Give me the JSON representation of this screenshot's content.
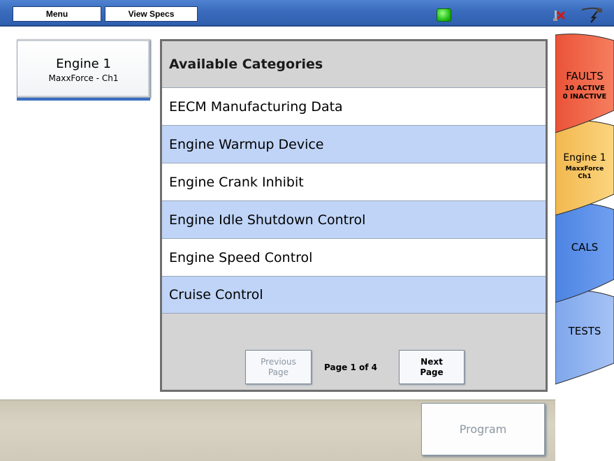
{
  "toolbar": {
    "menu_label": "Menu",
    "specs_label": "View Specs",
    "status_icon": "green-status-led-icon",
    "disconnect_icon": "disconnect-icon",
    "connector_icon": "connector-icon"
  },
  "module": {
    "title": "Engine 1",
    "subtitle": "MaxxForce - Ch1"
  },
  "categories": {
    "header": "Available Categories",
    "items": [
      {
        "label": "EECM Manufacturing Data"
      },
      {
        "label": "Engine Warmup Device"
      },
      {
        "label": "Engine Crank Inhibit"
      },
      {
        "label": "Engine Idle Shutdown Control"
      },
      {
        "label": "Engine Speed Control"
      },
      {
        "label": "Cruise Control"
      }
    ]
  },
  "pager": {
    "prev_line1": "Previous",
    "prev_line2": "Page",
    "page_text": "Page 1 of 4",
    "next_line1": "Next",
    "next_line2": "Page"
  },
  "program_label": "Program",
  "side_tabs": {
    "faults": {
      "label": "FAULTS",
      "line2": "10 ACTIVE",
      "line3": "0 INACTIVE",
      "color": "#f0684a"
    },
    "engine": {
      "label": "Engine 1",
      "line2": "MaxxForce",
      "line3": "Ch1",
      "color": "#f6c766"
    },
    "cals": {
      "label": "CALS",
      "color": "#5e93ea"
    },
    "tests": {
      "label": "TESTS",
      "color": "#90b5f2"
    }
  },
  "colors": {
    "row_alt": "#bfd4f7",
    "panel_gray": "#d4d4d4",
    "topbar_blue": "#3a6bbd"
  }
}
